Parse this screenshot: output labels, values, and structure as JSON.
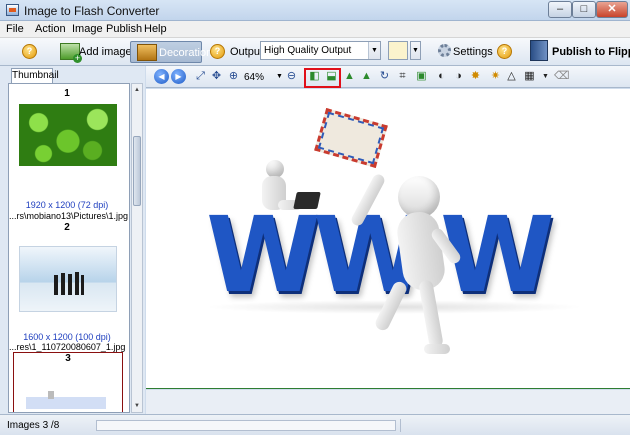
{
  "window": {
    "title": "Image to Flash Converter",
    "controls": {
      "minimize": "–",
      "maximize": "□",
      "close": "✕"
    }
  },
  "menu": [
    "File",
    "Action",
    "Image",
    "Publish",
    "Help"
  ],
  "toolbar": {
    "add_image_label": "Add image",
    "decoration_label": "Decoration",
    "output_label": "Output:",
    "output_value": "High Quality Output",
    "settings_label": "Settings",
    "publish_label": "Publish to Flippin",
    "help_glyph": "?"
  },
  "left_panel": {
    "tab_label": "Thumbnail",
    "thumbnails": [
      {
        "number": "1",
        "dimensions": "1920 x 1200 (72 dpi)",
        "path": "...rs\\mobiano13\\Pictures\\1.jpg",
        "icon": "clover-leaves-image"
      },
      {
        "number": "2",
        "dimensions": "1600 x 1200 (100 dpi)",
        "path": "...res\\1_110720080607_1.jpg",
        "icon": "business-people-image"
      },
      {
        "number": "3",
        "dimensions": "",
        "path": "",
        "icon": "www-image"
      }
    ]
  },
  "image_toolbar": {
    "zoom": "64%",
    "icons": [
      "prev-icon",
      "next-icon",
      "fit-icon",
      "move-icon",
      "zoom-in-icon",
      "zoom-out-icon",
      "flip-horizontal-icon",
      "flip-vertical-icon",
      "mirror-left-icon",
      "mirror-right-icon",
      "rotate-icon",
      "crop-icon",
      "resize-icon",
      "brightness-icon",
      "contrast-icon",
      "sharpen-icon",
      "effects-icon",
      "levels-icon",
      "layout-icon",
      "eraser-icon"
    ]
  },
  "canvas": {
    "www_letters": [
      "W",
      "W",
      "W"
    ]
  },
  "status": {
    "text": "Images 3 /8"
  },
  "colors": {
    "highlight": "#e0101a",
    "www_blue": "#1f56c4",
    "link_blue": "#1f3fbf"
  }
}
